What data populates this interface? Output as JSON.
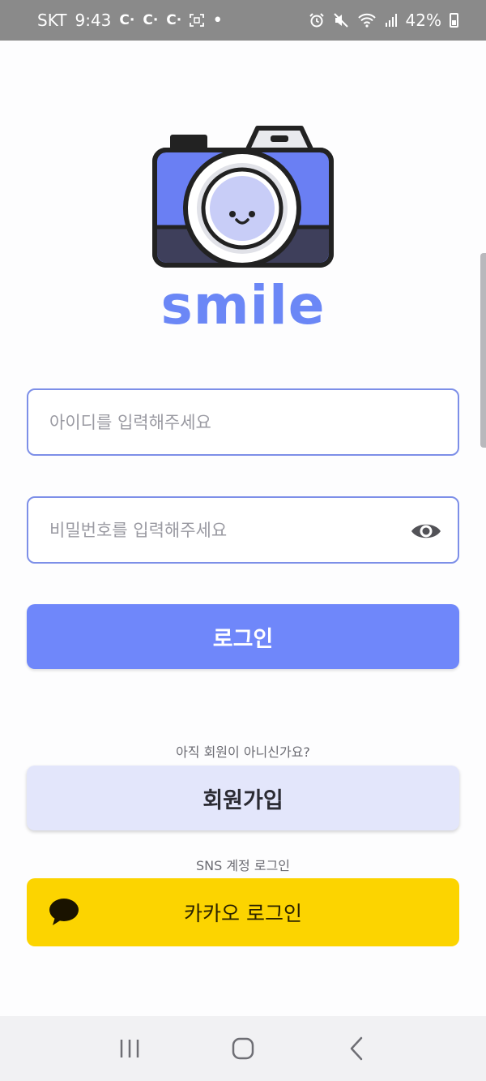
{
  "status_bar": {
    "carrier": "SKT",
    "time": "9:43",
    "notification_icons": [
      "C·",
      "C·",
      "C·"
    ],
    "battery": "42%"
  },
  "brand": {
    "name": "smile",
    "accent": "#6f87fa"
  },
  "login_form": {
    "id_placeholder": "아이디를 입력해주세요",
    "password_placeholder": "비밀번호를 입력해주세요",
    "login_label": "로그인"
  },
  "signup": {
    "prompt": "아직 회원이 아니신가요?",
    "button_label": "회원가입"
  },
  "sns": {
    "section_label": "SNS 계정 로그인",
    "kakao_label": "카카오 로그인",
    "kakao_color": "#fcd400"
  },
  "nav_bar": {
    "items": [
      "recent-apps-icon",
      "home-icon",
      "back-icon"
    ]
  }
}
